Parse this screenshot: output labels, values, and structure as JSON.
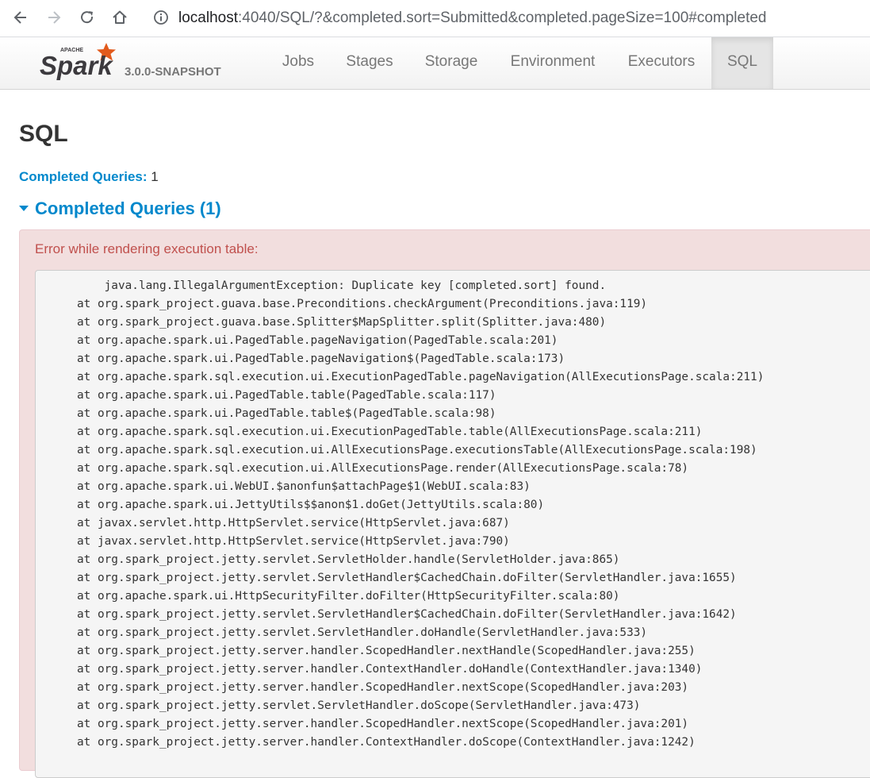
{
  "browser": {
    "url_host": "localhost",
    "url_rest": ":4040/SQL/?&completed.sort=Submitted&completed.pageSize=100#completed"
  },
  "navbar": {
    "logo_top_text": "APACHE",
    "logo_text": "Spark",
    "version": "3.0.0-SNAPSHOT",
    "tabs": [
      "Jobs",
      "Stages",
      "Storage",
      "Environment",
      "Executors",
      "SQL"
    ],
    "active_tab": "SQL"
  },
  "page": {
    "title": "SQL",
    "summary_label": "Completed Queries:",
    "summary_count": "1",
    "section_title": "Completed Queries (1)"
  },
  "error": {
    "message": "Error while rendering execution table:",
    "stacktrace": [
      "          java.lang.IllegalArgumentException: Duplicate key [completed.sort] found.",
      "      at org.spark_project.guava.base.Preconditions.checkArgument(Preconditions.java:119)",
      "      at org.spark_project.guava.base.Splitter$MapSplitter.split(Splitter.java:480)",
      "      at org.apache.spark.ui.PagedTable.pageNavigation(PagedTable.scala:201)",
      "      at org.apache.spark.ui.PagedTable.pageNavigation$(PagedTable.scala:173)",
      "      at org.apache.spark.sql.execution.ui.ExecutionPagedTable.pageNavigation(AllExecutionsPage.scala:211)",
      "      at org.apache.spark.ui.PagedTable.table(PagedTable.scala:117)",
      "      at org.apache.spark.ui.PagedTable.table$(PagedTable.scala:98)",
      "      at org.apache.spark.sql.execution.ui.ExecutionPagedTable.table(AllExecutionsPage.scala:211)",
      "      at org.apache.spark.sql.execution.ui.AllExecutionsPage.executionsTable(AllExecutionsPage.scala:198)",
      "      at org.apache.spark.sql.execution.ui.AllExecutionsPage.render(AllExecutionsPage.scala:78)",
      "      at org.apache.spark.ui.WebUI.$anonfun$attachPage$1(WebUI.scala:83)",
      "      at org.apache.spark.ui.JettyUtils$$anon$1.doGet(JettyUtils.scala:80)",
      "      at javax.servlet.http.HttpServlet.service(HttpServlet.java:687)",
      "      at javax.servlet.http.HttpServlet.service(HttpServlet.java:790)",
      "      at org.spark_project.jetty.servlet.ServletHolder.handle(ServletHolder.java:865)",
      "      at org.spark_project.jetty.servlet.ServletHandler$CachedChain.doFilter(ServletHandler.java:1655)",
      "      at org.apache.spark.ui.HttpSecurityFilter.doFilter(HttpSecurityFilter.scala:80)",
      "      at org.spark_project.jetty.servlet.ServletHandler$CachedChain.doFilter(ServletHandler.java:1642)",
      "      at org.spark_project.jetty.servlet.ServletHandler.doHandle(ServletHandler.java:533)",
      "      at org.spark_project.jetty.server.handler.ScopedHandler.nextHandle(ScopedHandler.java:255)",
      "      at org.spark_project.jetty.server.handler.ContextHandler.doHandle(ContextHandler.java:1340)",
      "      at org.spark_project.jetty.server.handler.ScopedHandler.nextScope(ScopedHandler.java:203)",
      "      at org.spark_project.jetty.servlet.ServletHandler.doScope(ServletHandler.java:473)",
      "      at org.spark_project.jetty.server.handler.ScopedHandler.nextScope(ScopedHandler.java:201)",
      "      at org.spark_project.jetty.server.handler.ContextHandler.doScope(ContextHandler.java:1242)"
    ]
  }
}
